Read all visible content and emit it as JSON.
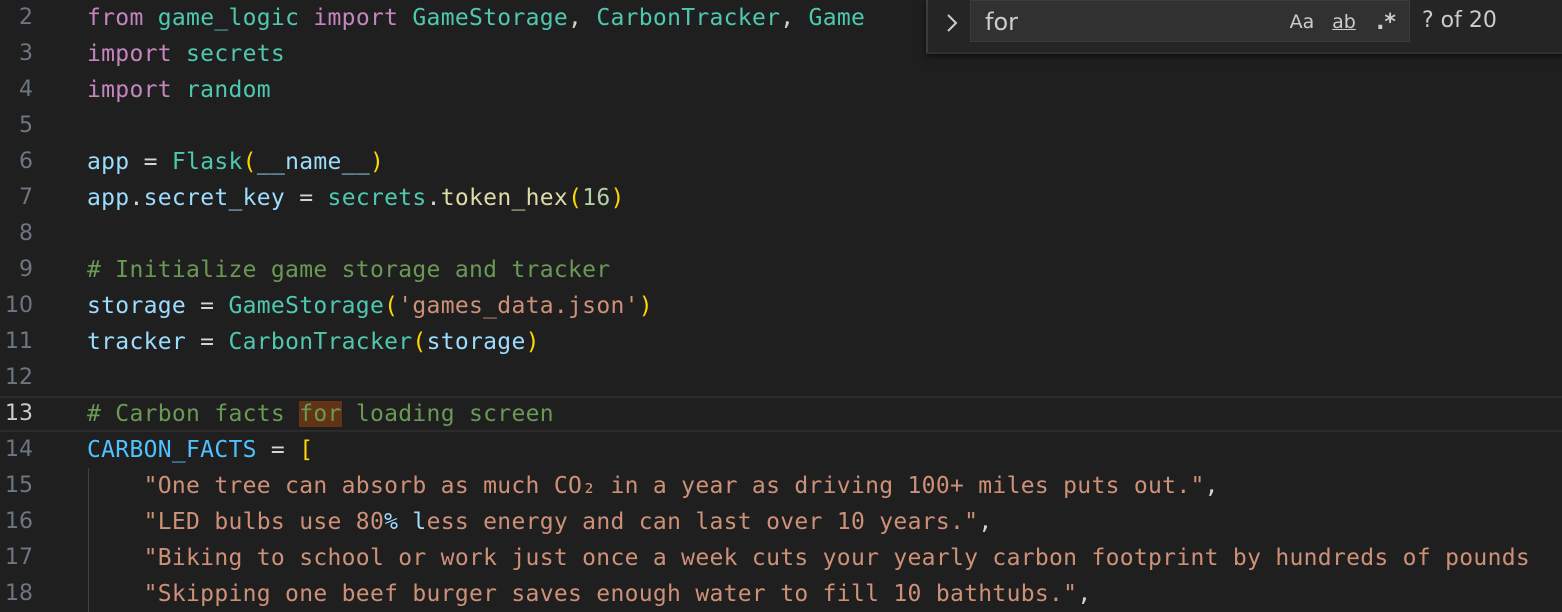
{
  "editor": {
    "active_line": 13,
    "lines": [
      {
        "n": "2",
        "tokens": [
          [
            "kw",
            "from "
          ],
          [
            "mod",
            "game_logic "
          ],
          [
            "kw",
            "import "
          ],
          [
            "cls",
            "GameStorage"
          ],
          [
            "op",
            ", "
          ],
          [
            "cls",
            "CarbonTracker"
          ],
          [
            "op",
            ", "
          ],
          [
            "cls",
            "Game"
          ]
        ]
      },
      {
        "n": "3",
        "tokens": [
          [
            "kw",
            "import "
          ],
          [
            "mod",
            "secrets"
          ]
        ]
      },
      {
        "n": "4",
        "tokens": [
          [
            "kw",
            "import "
          ],
          [
            "mod",
            "random"
          ]
        ]
      },
      {
        "n": "5",
        "tokens": []
      },
      {
        "n": "6",
        "tokens": [
          [
            "var",
            "app"
          ],
          [
            "op",
            " = "
          ],
          [
            "cls",
            "Flask"
          ],
          [
            "p1",
            "("
          ],
          [
            "var",
            "__name__"
          ],
          [
            "p1",
            ")"
          ]
        ]
      },
      {
        "n": "7",
        "tokens": [
          [
            "var",
            "app"
          ],
          [
            "op",
            "."
          ],
          [
            "var",
            "secret_key"
          ],
          [
            "op",
            " = "
          ],
          [
            "mod",
            "secrets"
          ],
          [
            "op",
            "."
          ],
          [
            "fn",
            "token_hex"
          ],
          [
            "p1",
            "("
          ],
          [
            "num",
            "16"
          ],
          [
            "p1",
            ")"
          ]
        ]
      },
      {
        "n": "8",
        "tokens": []
      },
      {
        "n": "9",
        "tokens": [
          [
            "cmt",
            "# Initialize game storage and tracker"
          ]
        ]
      },
      {
        "n": "10",
        "tokens": [
          [
            "var",
            "storage"
          ],
          [
            "op",
            " = "
          ],
          [
            "cls",
            "GameStorage"
          ],
          [
            "p1",
            "("
          ],
          [
            "str",
            "'games_data.json'"
          ],
          [
            "p1",
            ")"
          ]
        ]
      },
      {
        "n": "11",
        "tokens": [
          [
            "var",
            "tracker"
          ],
          [
            "op",
            " = "
          ],
          [
            "cls",
            "CarbonTracker"
          ],
          [
            "p1",
            "("
          ],
          [
            "var",
            "storage"
          ],
          [
            "p1",
            ")"
          ]
        ]
      },
      {
        "n": "12",
        "tokens": []
      },
      {
        "n": "13",
        "tokens": [
          [
            "cmt",
            "# Carbon facts "
          ],
          [
            "cmt hl",
            "for"
          ],
          [
            "cmt",
            " loading screen"
          ]
        ]
      },
      {
        "n": "14",
        "tokens": [
          [
            "const",
            "CARBON_FACTS"
          ],
          [
            "op",
            " = "
          ],
          [
            "p1",
            "["
          ]
        ]
      },
      {
        "n": "15",
        "indent": true,
        "tokens": [
          [
            "str",
            "    \"One tree can absorb as much CO₂ in a year as driving 100+ miles puts out.\""
          ],
          [
            "op",
            ","
          ]
        ]
      },
      {
        "n": "16",
        "indent": true,
        "tokens": [
          [
            "str",
            "    \"LED bulbs use 80"
          ],
          [
            "var",
            "%"
          ],
          [
            "str",
            " "
          ],
          [
            "var",
            "l"
          ],
          [
            "str",
            "ess energy and can last over 10 years.\""
          ],
          [
            "op",
            ","
          ]
        ]
      },
      {
        "n": "17",
        "indent": true,
        "tokens": [
          [
            "str",
            "    \"Biking to school or work just once a week cuts your yearly carbon footprint by hundreds of pounds"
          ]
        ]
      },
      {
        "n": "18",
        "indent": true,
        "tokens": [
          [
            "str",
            "    \"Skipping one beef burger saves enough water to fill 10 bathtubs.\""
          ],
          [
            "op",
            ","
          ]
        ]
      }
    ]
  },
  "find_widget": {
    "toggle_icon": "chevron-right-icon",
    "query": "for",
    "match_case_label": "Aa",
    "whole_word_label": "ab",
    "regex_label": ".*",
    "match_count": "? of 20"
  }
}
